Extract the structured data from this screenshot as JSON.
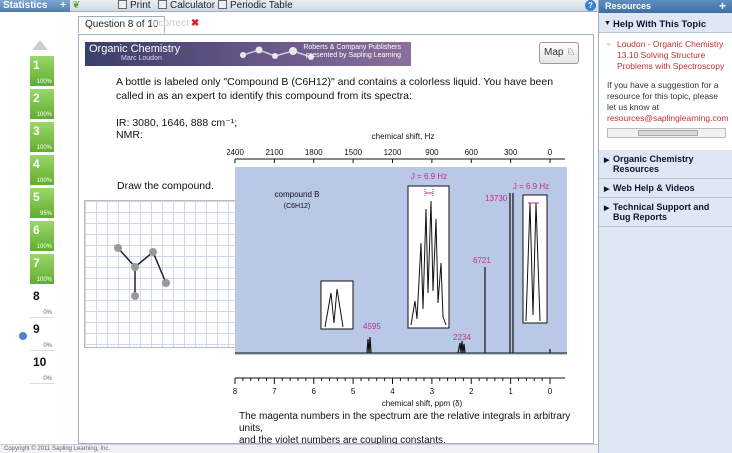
{
  "toolbar": {
    "statistics_label": "Statistics",
    "print_label": "Print",
    "calculator_label": "Calculator",
    "periodic_table_label": "Periodic Table"
  },
  "question_tabs": {
    "current": "Question 8 of 10",
    "status": "Incorrect"
  },
  "sidebar": {
    "items": [
      {
        "num": "1",
        "pct": "100%",
        "state": "done"
      },
      {
        "num": "2",
        "pct": "100%",
        "state": "done"
      },
      {
        "num": "3",
        "pct": "100%",
        "state": "done"
      },
      {
        "num": "4",
        "pct": "100%",
        "state": "done"
      },
      {
        "num": "5",
        "pct": "95%",
        "state": "done"
      },
      {
        "num": "6",
        "pct": "100%",
        "state": "done"
      },
      {
        "num": "7",
        "pct": "100%",
        "state": "done"
      },
      {
        "num": "8",
        "pct": "0%",
        "state": "todo"
      },
      {
        "num": "9",
        "pct": "0%",
        "state": "todo"
      },
      {
        "num": "10",
        "pct": "0%",
        "state": "todo"
      }
    ]
  },
  "banner": {
    "title": "Organic Chemistry",
    "author": "Marc Loudon",
    "publisher_line1": "Roberts & Company Publishers",
    "publisher_line2": "presented by Sapling Learning"
  },
  "map_button": "Map",
  "question": {
    "prompt": "A bottle is labeled only \"Compound B (C6H12)\" and contains a colorless liquid. You have been called in as an expert to identify this compound from its spectra:",
    "ir": "IR: 3080, 1646, 888 cm⁻¹;",
    "nmr": "NMR:",
    "draw_label": "Draw the compound.",
    "footnote_line1": "The magenta numbers in the spectrum are the relative integrals in arbitrary units,",
    "footnote_line2": "and the violet numbers are coupling constants."
  },
  "spectrum": {
    "top_axis_title": "chemical shift, Hz",
    "top_ticks": [
      "2400",
      "2100",
      "1800",
      "1500",
      "1200",
      "900",
      "600",
      "300",
      "0"
    ],
    "bottom_axis_title": "chemical shift, ppm (δ)",
    "bottom_ticks": [
      "8",
      "7",
      "6",
      "5",
      "4",
      "3",
      "2",
      "1",
      "0"
    ],
    "compound_label": "compound B",
    "compound_formula": "(C6H12)",
    "coupling_1": "J = 6.9 Hz",
    "coupling_2": "J = 6.9 Hz",
    "integrals": [
      "4595",
      "2234",
      "6721",
      "13730"
    ],
    "colors": {
      "background": "#b8c8e6",
      "integral": "#cc2a8f",
      "coupling": "#8a2fc0"
    }
  },
  "resources": {
    "header": "Resources",
    "help_section": "Help With This Topic",
    "link": "Loudon - Organic Chemistry 13.10 Solving Structure Problems with Spectroscopy",
    "note": "If you have a suggestion for a resource for this topic, please let us know at",
    "email": "resources@saplinglearning.com",
    "items": [
      "Organic Chemistry Resources",
      "Web Help & Videos",
      "Technical Support and Bug Reports"
    ]
  },
  "footer_text": "Copyright © 2011 Sapling Learning, Inc."
}
